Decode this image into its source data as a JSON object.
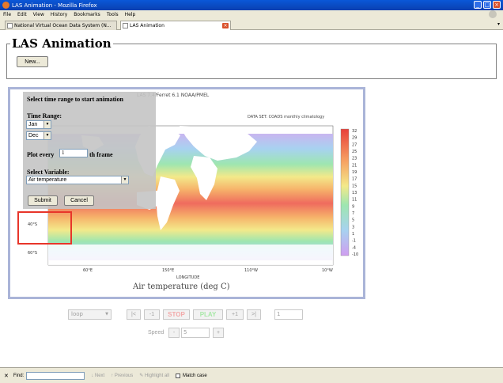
{
  "window": {
    "title": "LAS Animation - Mozilla Firefox"
  },
  "menu": [
    "File",
    "Edit",
    "View",
    "History",
    "Bookmarks",
    "Tools",
    "Help"
  ],
  "tabs": [
    {
      "label": "National Virtual Ocean Data System (N...",
      "active": false
    },
    {
      "label": "LAS Animation",
      "active": true
    }
  ],
  "page": {
    "heading": "LAS Animation",
    "new_button": "New..."
  },
  "plot": {
    "header": "LAS 7.4/Ferret 6.1     NOAA/PMEL",
    "dataset": "DATA SET: COADS monthly climatology",
    "title": "Air temperature (deg C)",
    "xlabel": "LONGITUDE",
    "lat_labels": [
      "40°S",
      "60°S"
    ],
    "lon_labels": [
      "60°E",
      "150°E",
      "110°W",
      "10°W"
    ],
    "colorbar_ticks": [
      "32",
      "29",
      "27",
      "25",
      "23",
      "21",
      "19",
      "17",
      "15",
      "13",
      "11",
      "9",
      "7",
      "5",
      "3",
      "1",
      "-1",
      "-4",
      "-10"
    ]
  },
  "panel": {
    "title": "Select time range to start animation",
    "time_range_label": "Time Range:",
    "start_month": "Jan",
    "end_month": "Dec",
    "plot_every_prefix": "Plot every",
    "plot_every_value": "1",
    "plot_every_suffix": "th frame",
    "variable_label": "Select Variable:",
    "variable_value": "Air temperature",
    "submit": "Submit",
    "cancel": "Cancel"
  },
  "controls": {
    "loop": "loop",
    "first": "|<",
    "back": "-1",
    "stop": "STOP",
    "play": "PLAY",
    "forward": "+1",
    "last": ">|",
    "frame": "1",
    "speed_label": "Speed",
    "speed_minus": "-",
    "speed_value": "5",
    "speed_plus": "+"
  },
  "findbar": {
    "close": "✕",
    "label": "Find:",
    "next": "Next",
    "previous": "Previous",
    "highlight": "Highlight all",
    "match_case": "Match case"
  },
  "colors": {
    "highlight_box": "#e8352a",
    "plot_border": "#aab4d8",
    "titlebar": "#0a58d8"
  }
}
